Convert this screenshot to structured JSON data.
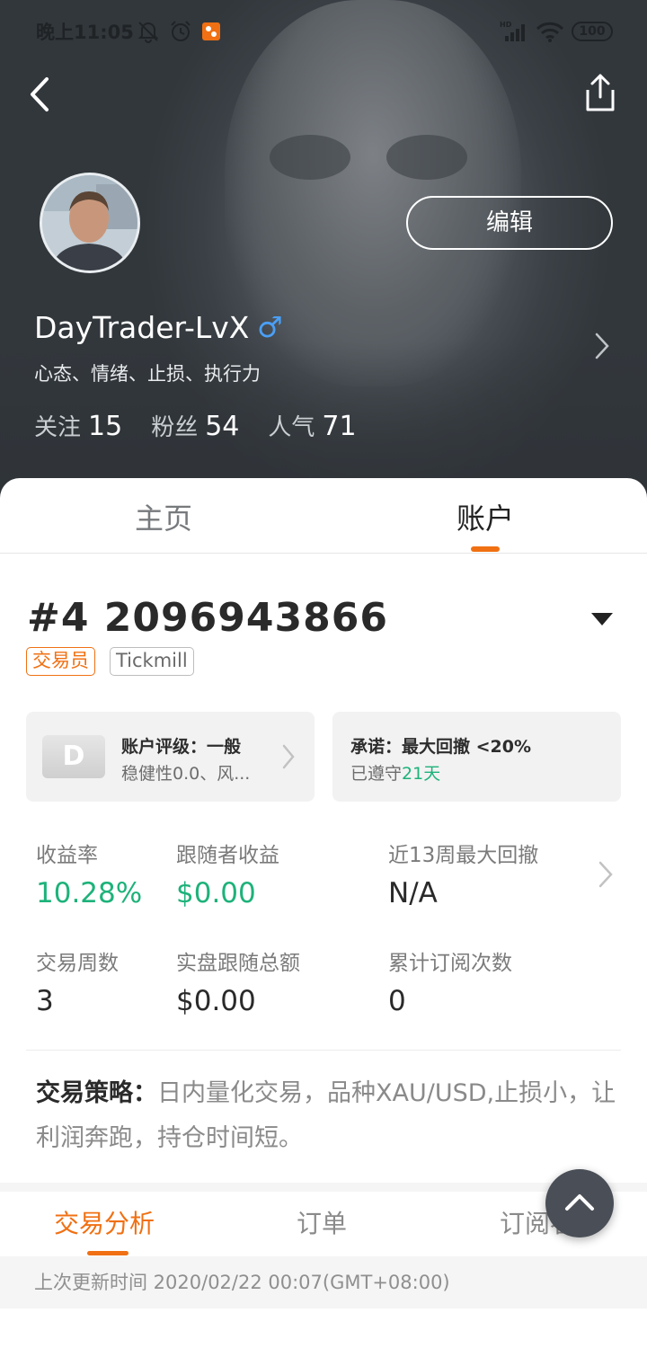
{
  "status_bar": {
    "time": "晚上11:05",
    "battery": "100",
    "signal_label": "HD",
    "icons": [
      "bell-off-icon",
      "alarm-icon",
      "app-notification-icon",
      "signal-icon",
      "wifi-icon",
      "battery-icon"
    ]
  },
  "header": {
    "back_icon": "chevron-left-icon",
    "share_icon": "share-icon",
    "edit_label": "编辑",
    "username": "DayTrader-LvX",
    "gender_symbol": "♂",
    "bio": "心态、情绪、止损、执行力",
    "stats": [
      {
        "label": "关注",
        "value": "15"
      },
      {
        "label": "粉丝",
        "value": "54"
      },
      {
        "label": "人气",
        "value": "71"
      }
    ]
  },
  "tabs": [
    {
      "label": "主页",
      "active": false
    },
    {
      "label": "账户",
      "active": true
    }
  ],
  "account": {
    "title": "#4 2096943866",
    "tags": [
      "交易员",
      "Tickmill"
    ],
    "rating_card": {
      "badge": "D",
      "line1": "账户评级：一般",
      "line2": "稳健性0.0、风..."
    },
    "promise_card": {
      "line1": "承诺：最大回撤 <20%",
      "line2_prefix": "已遵守",
      "line2_days": "21天"
    },
    "metrics": [
      {
        "label": "收益率",
        "value": "10.28%"
      },
      {
        "label": "跟随者收益",
        "value": "$0.00"
      },
      {
        "label": "近13周最大回撤",
        "value": "N/A"
      },
      {
        "label": "交易周数",
        "value": "3"
      },
      {
        "label": "实盘跟随总额",
        "value": "$0.00"
      },
      {
        "label": "累计订阅次数",
        "value": "0"
      }
    ],
    "strategy_label": "交易策略：",
    "strategy_text": "日内量化交易，品种XAU/USD,止损小，让利润奔跑，持仓时间短。"
  },
  "sub_tabs": [
    {
      "label": "交易分析",
      "active": true
    },
    {
      "label": "订单",
      "active": false
    },
    {
      "label": "订阅者",
      "active": false
    }
  ],
  "last_update": "上次更新时间 2020/02/22 00:07(GMT+08:00)",
  "colors": {
    "accent": "#f07013",
    "positive": "#1db27a",
    "gender": "#4a9ff5",
    "fab": "#4a4f57"
  }
}
